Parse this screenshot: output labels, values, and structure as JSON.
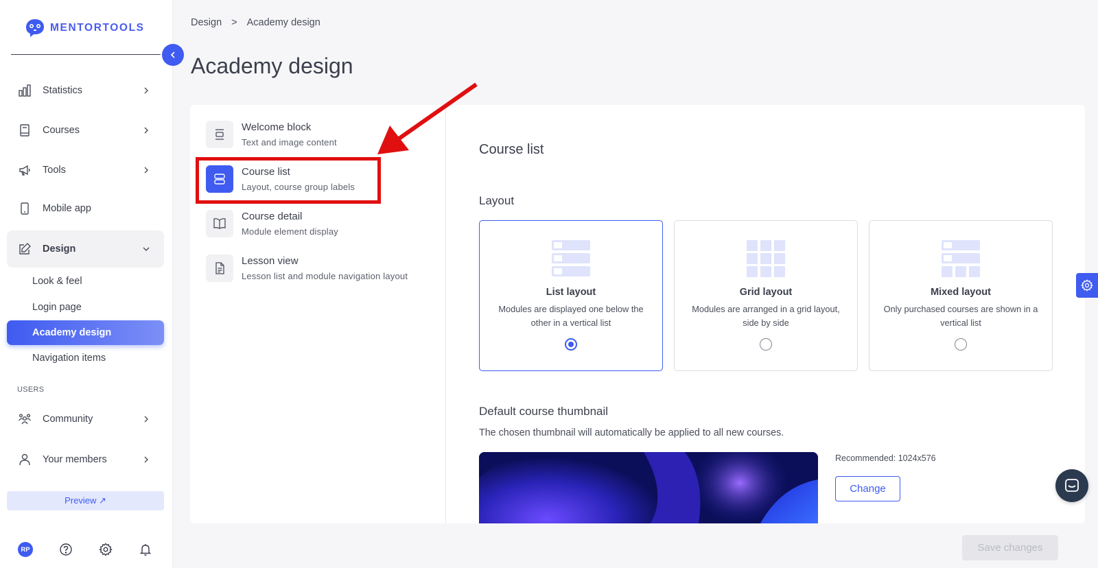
{
  "brand": {
    "name": "MENTORTOOLS",
    "accent_color": "#3f5bf0"
  },
  "sidebar": {
    "items": [
      {
        "label": "Statistics",
        "icon": "bar-chart-icon"
      },
      {
        "label": "Courses",
        "icon": "book-icon"
      },
      {
        "label": "Tools",
        "icon": "megaphone-icon"
      },
      {
        "label": "Mobile app",
        "icon": "phone-icon"
      },
      {
        "label": "Design",
        "icon": "pencil-icon",
        "expanded": true
      }
    ],
    "design_subitems": [
      {
        "label": "Look & feel"
      },
      {
        "label": "Login page"
      },
      {
        "label": "Academy design",
        "active": true
      },
      {
        "label": "Navigation items"
      }
    ],
    "users_section_label": "USERS",
    "users_items": [
      {
        "label": "Community",
        "icon": "people-icon"
      },
      {
        "label": "Your members",
        "icon": "user-icon"
      }
    ],
    "preview_label": "Preview ↗",
    "avatar_initials": "RP"
  },
  "breadcrumb": {
    "parent": "Design",
    "separator": ">",
    "current": "Academy design"
  },
  "page_title": "Academy design",
  "settings_menu": [
    {
      "title": "Welcome block",
      "subtitle": "Text and image content",
      "icon": "align-center-icon"
    },
    {
      "title": "Course list",
      "subtitle": "Layout, course group labels",
      "icon": "list-layout-icon",
      "active": true
    },
    {
      "title": "Course detail",
      "subtitle": "Module element display",
      "icon": "open-book-icon"
    },
    {
      "title": "Lesson view",
      "subtitle": "Lesson list and module navigation layout",
      "icon": "document-icon"
    }
  ],
  "course_list": {
    "title": "Course list",
    "layout_label": "Layout",
    "layouts": [
      {
        "title": "List layout",
        "description": "Modules are displayed one below the other in a vertical list",
        "selected": true
      },
      {
        "title": "Grid layout",
        "description": "Modules are arranged in a grid layout, side by side",
        "selected": false
      },
      {
        "title": "Mixed layout",
        "description": "Only purchased courses are shown in a vertical list",
        "selected": false
      }
    ],
    "thumbnail": {
      "title": "Default course thumbnail",
      "description": "The chosen thumbnail will automatically be applied to all new courses.",
      "recommended": "Recommended: 1024x576",
      "change_label": "Change"
    }
  },
  "save_label": "Save changes",
  "annotation_color": "#e01010"
}
